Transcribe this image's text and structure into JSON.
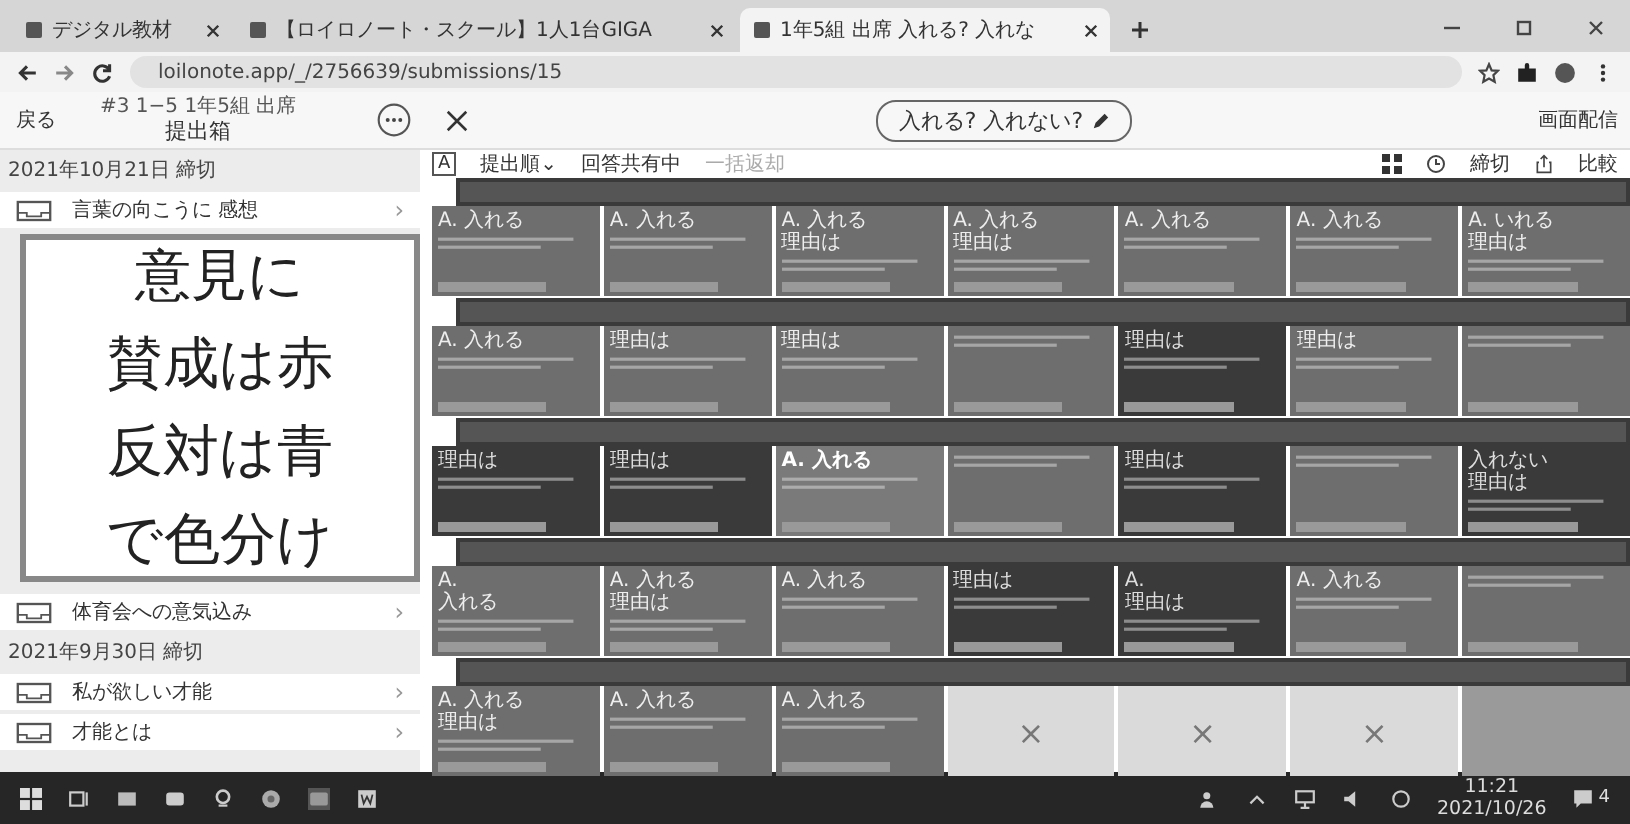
{
  "browser": {
    "tabs": [
      {
        "title": "デジタル教材",
        "selected": false
      },
      {
        "title": "【ロイロノート・スクール】1人1台GIGA",
        "selected": false
      },
      {
        "title": "1年5組 出席 入れる? 入れな",
        "selected": true
      }
    ],
    "url": "loilonote.app/_/2756639/submissions/15"
  },
  "header": {
    "back": "戻る",
    "subtitle": "#3 1−5 1年5組 出席",
    "title": "提出箱",
    "prompt": "入れる? 入れない?",
    "broadcast": "画面配信"
  },
  "sidebar": {
    "sections": [
      {
        "date": "2021年10月21日 締切",
        "items": [
          {
            "title": "言葉の向こうに 感想",
            "chevron": "›"
          }
        ]
      },
      {
        "items": [
          {
            "title": "体育会への意気込み",
            "chevron": "›"
          }
        ]
      },
      {
        "date": "2021年9月30日 締切",
        "items": [
          {
            "title": "私が欲しい才能",
            "chevron": "›"
          },
          {
            "title": "才能とは",
            "chevron": "›"
          }
        ]
      }
    ]
  },
  "toolbar": {
    "font_size": "A",
    "order": "提出順⌄",
    "sharing": "回答共有中",
    "return_all": "一括返却",
    "deadline": "締切",
    "compare": "比較"
  },
  "groups": [
    {
      "cards": [
        {
          "kind": "light",
          "lines": [
            "A. 入れる"
          ]
        },
        {
          "kind": "light",
          "lines": [
            "A. 入れる"
          ]
        },
        {
          "kind": "light",
          "lines": [
            "A. 入れる",
            "理由は"
          ]
        },
        {
          "kind": "light",
          "lines": [
            "A. 入れる",
            "理由は"
          ]
        },
        {
          "kind": "light",
          "lines": [
            "A. 入れる"
          ]
        },
        {
          "kind": "light",
          "lines": [
            "A. 入れる"
          ]
        },
        {
          "kind": "light",
          "lines": [
            "A. いれる",
            "理由は"
          ]
        }
      ]
    },
    {
      "cards": [
        {
          "kind": "light",
          "lines": [
            "A. 入れる"
          ]
        },
        {
          "kind": "light",
          "lines": [
            "理由は"
          ]
        },
        {
          "kind": "light",
          "lines": [
            "理由は"
          ]
        },
        {
          "kind": "light"
        },
        {
          "kind": "dark",
          "lines": [
            "理由は"
          ]
        },
        {
          "kind": "light",
          "lines": [
            "理由は"
          ]
        },
        {
          "kind": "light"
        }
      ]
    },
    {
      "cards": [
        {
          "kind": "dark",
          "lines": [
            "理由は"
          ]
        },
        {
          "kind": "dark",
          "lines": [
            "理由は"
          ]
        },
        {
          "kind": "highlight",
          "lines": [
            "A. 入れる"
          ]
        },
        {
          "kind": "light"
        },
        {
          "kind": "dark",
          "lines": [
            "理由は"
          ]
        },
        {
          "kind": "light"
        },
        {
          "kind": "dark",
          "lines": [
            "入れない",
            "理由は"
          ]
        }
      ]
    },
    {
      "cards": [
        {
          "kind": "light",
          "lines": [
            "A.",
            "入れる"
          ]
        },
        {
          "kind": "light",
          "lines": [
            "A. 入れる",
            "理由は"
          ]
        },
        {
          "kind": "light",
          "lines": [
            "A. 入れる"
          ]
        },
        {
          "kind": "dark",
          "lines": [
            "理由は"
          ]
        },
        {
          "kind": "dark",
          "lines": [
            "A.",
            "理由は"
          ]
        },
        {
          "kind": "light",
          "lines": [
            "A. 入れる"
          ]
        },
        {
          "kind": "light"
        }
      ]
    },
    {
      "cards": [
        {
          "kind": "light",
          "lines": [
            "A. 入れる",
            "理由は"
          ]
        },
        {
          "kind": "light",
          "lines": [
            "A. 入れる"
          ]
        },
        {
          "kind": "light",
          "lines": [
            "A. 入れる"
          ]
        },
        {
          "kind": "empty",
          "mark": "×"
        },
        {
          "kind": "empty",
          "mark": "×"
        },
        {
          "kind": "empty",
          "mark": "×"
        },
        {
          "kind": "blank"
        }
      ]
    }
  ],
  "annotation": {
    "lines": [
      "意見に",
      "賛成は赤",
      "反対は青",
      "で色分け"
    ]
  },
  "taskbar": {
    "time": "11:21",
    "date": "2021/10/26",
    "notifications": "4"
  }
}
